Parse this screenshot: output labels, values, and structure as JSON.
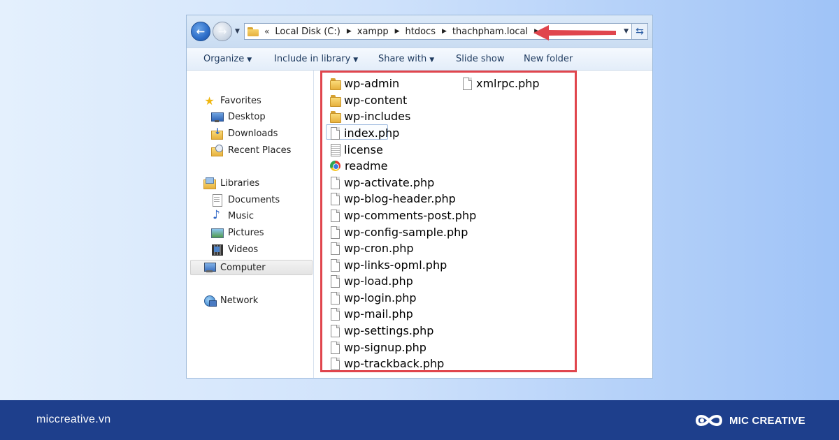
{
  "window": {
    "address": {
      "overflow": "«",
      "crumbs": [
        "Local Disk (C:)",
        "xampp",
        "htdocs",
        "thachpham.local"
      ]
    },
    "toolbar": {
      "organize": "Organize",
      "include_in_library": "Include in library",
      "share_with": "Share with",
      "slide_show": "Slide show",
      "new_folder": "New folder"
    },
    "nav": {
      "favorites": "Favorites",
      "desktop": "Desktop",
      "downloads": "Downloads",
      "recent_places": "Recent Places",
      "libraries": "Libraries",
      "documents": "Documents",
      "music": "Music",
      "pictures": "Pictures",
      "videos": "Videos",
      "computer": "Computer",
      "network": "Network"
    },
    "files": [
      {
        "name": "wp-admin",
        "icon": "folder-icon"
      },
      {
        "name": "wp-content",
        "icon": "folder-icon"
      },
      {
        "name": "wp-includes",
        "icon": "folder-icon"
      },
      {
        "name": "index.php",
        "icon": "file-icon"
      },
      {
        "name": "license",
        "icon": "text-file-icon"
      },
      {
        "name": "readme",
        "icon": "chrome-icon"
      },
      {
        "name": "wp-activate.php",
        "icon": "file-icon"
      },
      {
        "name": "wp-blog-header.php",
        "icon": "file-icon"
      },
      {
        "name": "wp-comments-post.php",
        "icon": "file-icon"
      },
      {
        "name": "wp-config-sample.php",
        "icon": "file-icon"
      },
      {
        "name": "wp-cron.php",
        "icon": "file-icon"
      },
      {
        "name": "wp-links-opml.php",
        "icon": "file-icon"
      },
      {
        "name": "wp-load.php",
        "icon": "file-icon"
      },
      {
        "name": "wp-login.php",
        "icon": "file-icon"
      },
      {
        "name": "wp-mail.php",
        "icon": "file-icon"
      },
      {
        "name": "wp-settings.php",
        "icon": "file-icon"
      },
      {
        "name": "wp-signup.php",
        "icon": "file-icon"
      },
      {
        "name": "wp-trackback.php",
        "icon": "file-icon"
      },
      {
        "name": "xmlrpc.php",
        "icon": "file-icon"
      }
    ],
    "selected_file": "index.php"
  },
  "footer": {
    "url": "miccreative.vn",
    "brand": "MIC CREATIVE"
  },
  "colors": {
    "highlight": "#e0454d",
    "footer_bg": "#1e3f8c"
  }
}
